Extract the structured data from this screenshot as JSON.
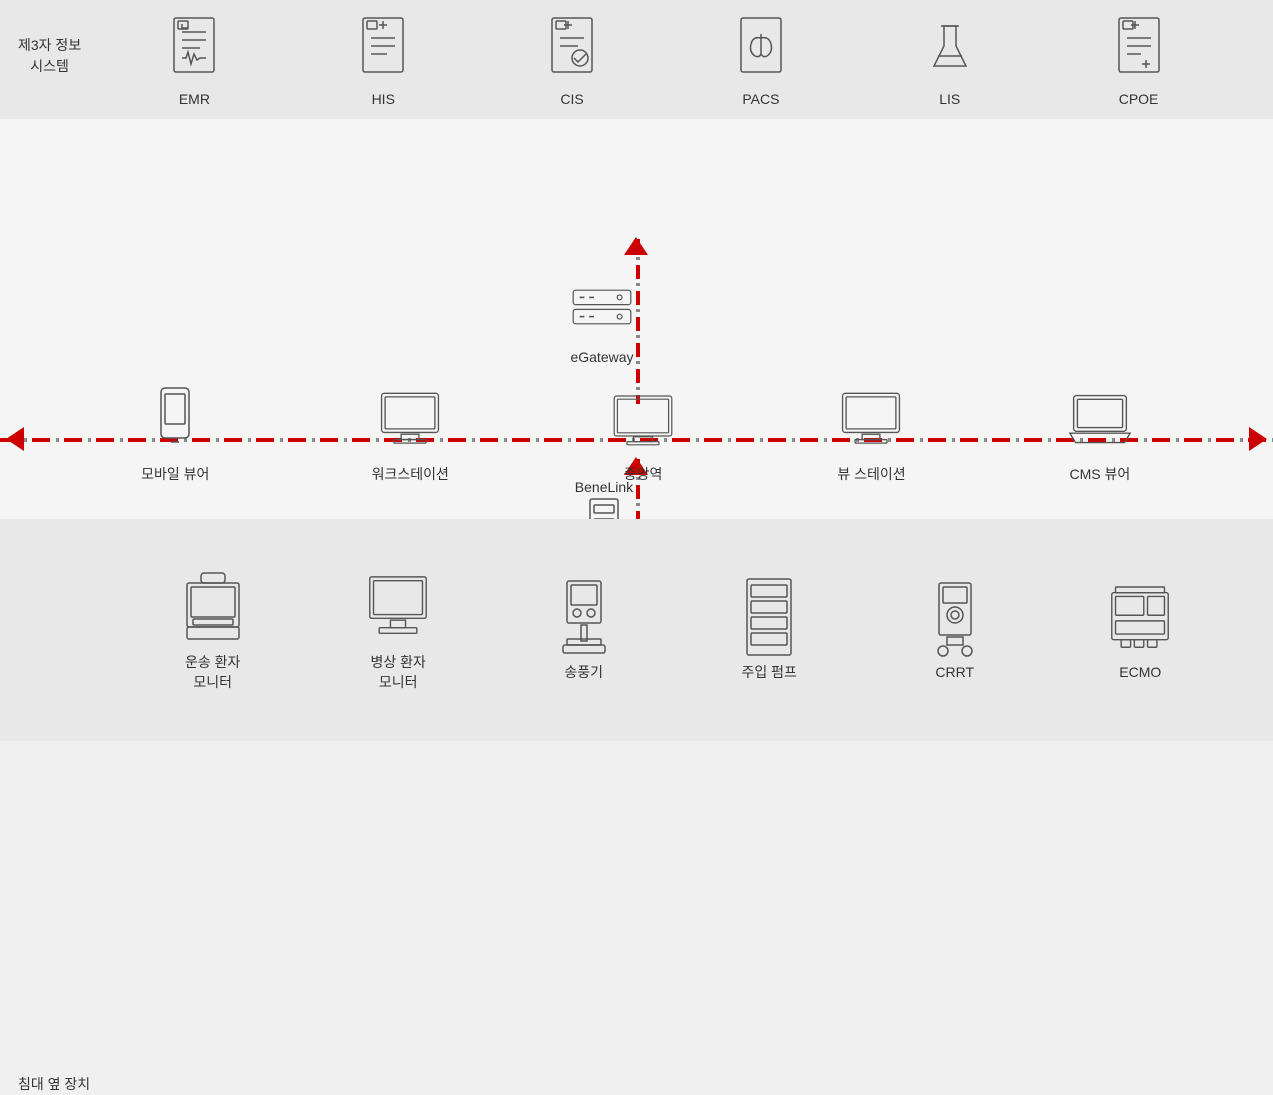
{
  "section_labels": {
    "top": "제3자 정보\n시스템",
    "bottom": "침대 옆 장치"
  },
  "top_devices": [
    {
      "id": "emr",
      "label": "EMR"
    },
    {
      "id": "his",
      "label": "HIS"
    },
    {
      "id": "cis",
      "label": "CIS"
    },
    {
      "id": "pacs",
      "label": "PACS"
    },
    {
      "id": "lis",
      "label": "LIS"
    },
    {
      "id": "cpoe",
      "label": "CPOE"
    }
  ],
  "middle_devices": [
    {
      "id": "mobile",
      "label": "모바일 뷰어"
    },
    {
      "id": "workstation",
      "label": "워크스테이션"
    },
    {
      "id": "central",
      "label": "중앙역"
    },
    {
      "id": "viewstation",
      "label": "뷰 스테이션"
    },
    {
      "id": "cms",
      "label": "CMS 뷰어"
    }
  ],
  "gateway": {
    "id": "egateway",
    "label": "eGateway"
  },
  "benelink": {
    "id": "benelink",
    "label": "BeneLink"
  },
  "bottom_devices": [
    {
      "id": "transport-monitor",
      "label": "운송 환자\n모니터"
    },
    {
      "id": "bedside-monitor",
      "label": "병상 환자\n모니터"
    },
    {
      "id": "ventilator",
      "label": "송풍기"
    },
    {
      "id": "infusion-pump",
      "label": "주입 펌프"
    },
    {
      "id": "crrt",
      "label": "CRRT"
    },
    {
      "id": "ecmo",
      "label": "ECMO"
    }
  ]
}
